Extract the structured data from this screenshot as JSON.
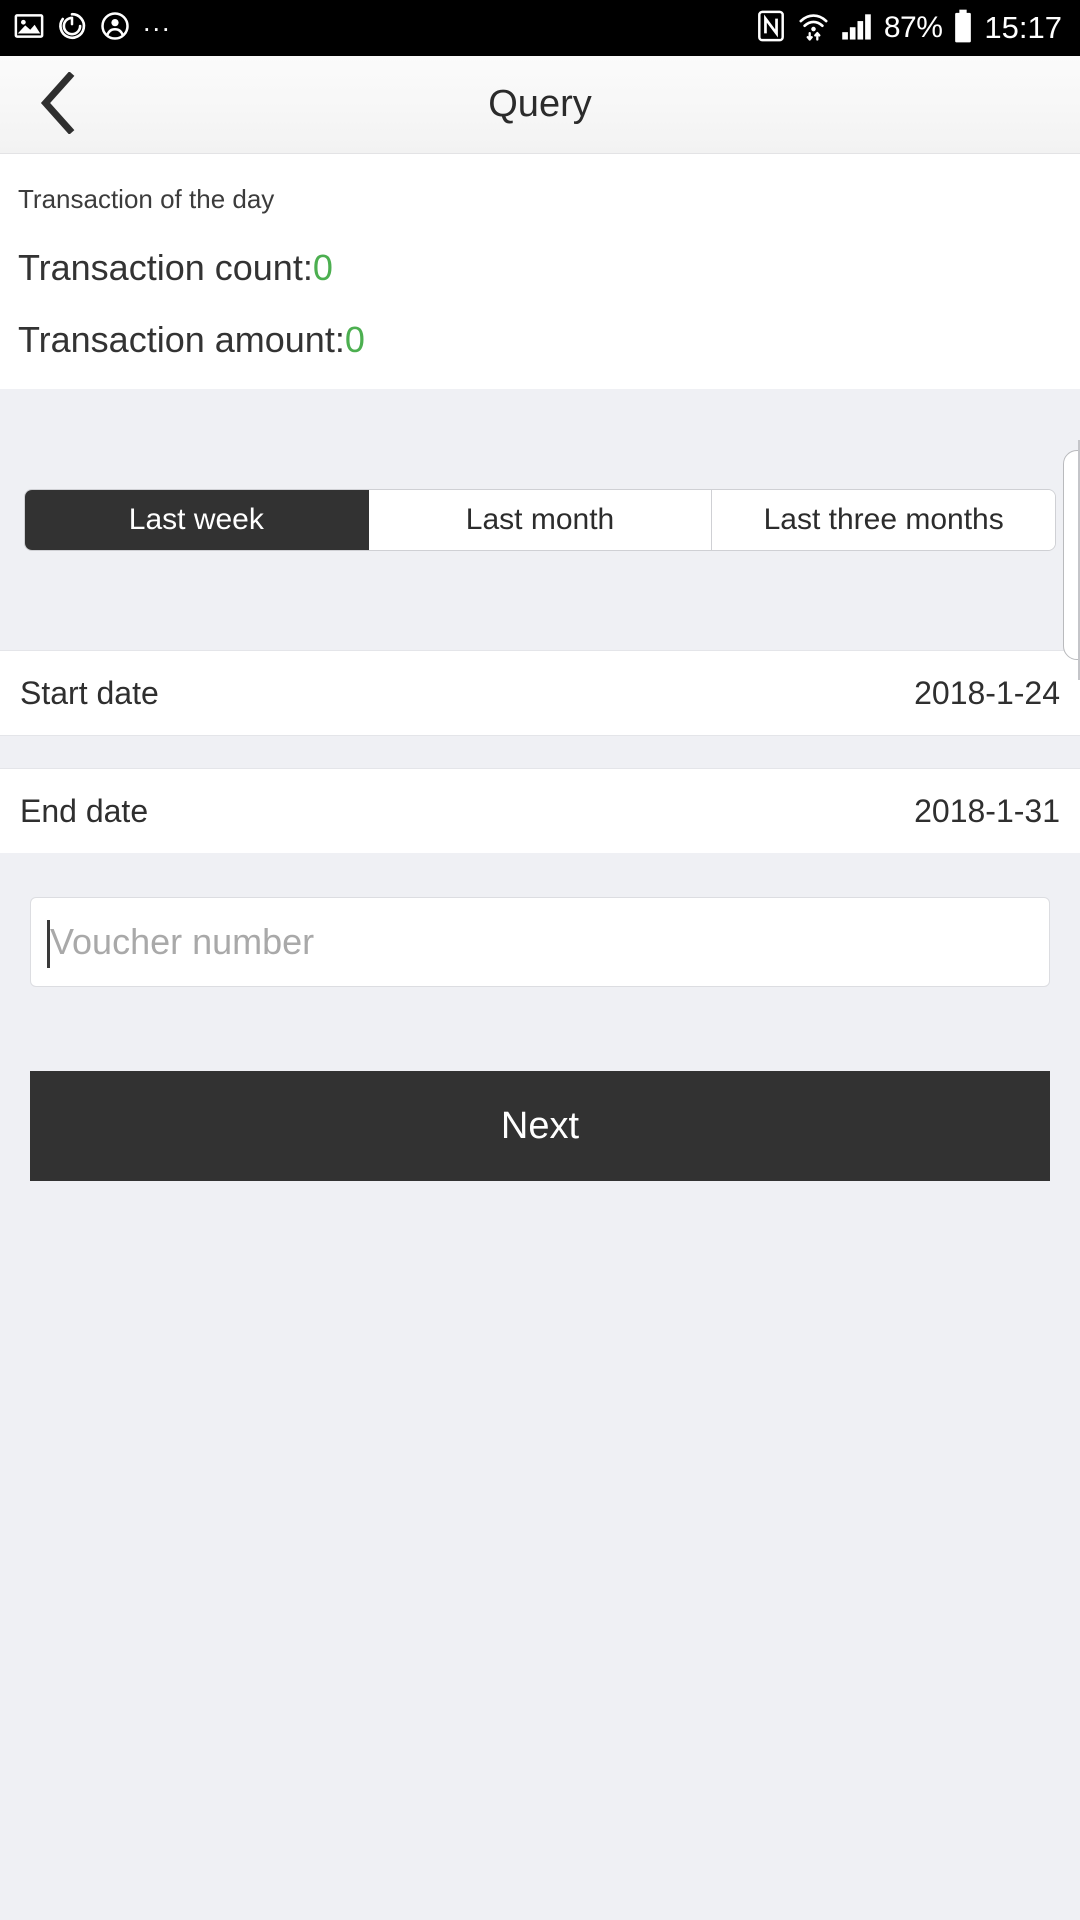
{
  "status_bar": {
    "icons_left": [
      "image-icon",
      "power-sync-icon",
      "account-icon"
    ],
    "overflow_dots": "...",
    "icons_right": [
      "nfc-icon",
      "wifi-icon",
      "signal-icon",
      "battery-icon"
    ],
    "battery_percent": "87%",
    "time": "15:17"
  },
  "header": {
    "back_icon": "chevron-left-icon",
    "title": "Query"
  },
  "summary": {
    "subtitle": "Transaction of the day",
    "count_label": "Transaction count:",
    "count_value": "0",
    "amount_label": "Transaction amount:",
    "amount_value": "0",
    "value_color": "#4caf50"
  },
  "range_tabs": {
    "items": [
      {
        "label": "Last week",
        "selected": true
      },
      {
        "label": "Last month",
        "selected": false
      },
      {
        "label": "Last three months",
        "selected": false
      }
    ],
    "active_bg": "#323232",
    "active_fg": "#ffffff"
  },
  "dates": {
    "start": {
      "label": "Start date",
      "value": "2018-1-24"
    },
    "end": {
      "label": "End date",
      "value": "2018-1-31"
    }
  },
  "voucher": {
    "placeholder": "Voucher number",
    "value": ""
  },
  "next_button": {
    "label": "Next",
    "bg": "#323232",
    "fg": "#ffffff"
  }
}
